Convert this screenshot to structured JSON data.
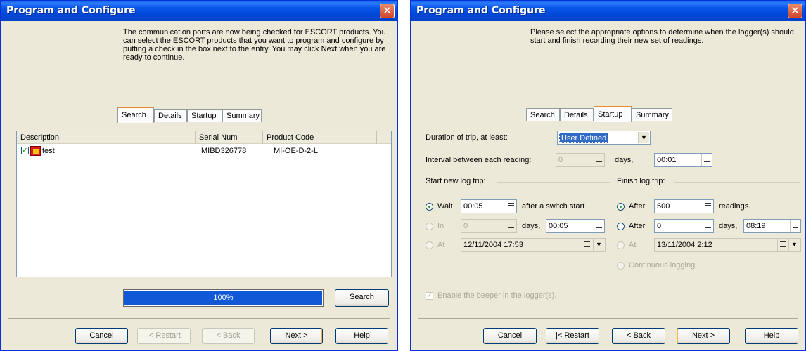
{
  "left_dialog": {
    "title": "Program and Configure",
    "close_glyph": "✕",
    "intro_text": "The communication ports are now being checked for ESCORT products. You can select the ESCORT products that you want to program and configure by putting a check in the box next to the entry. You may click Next when you are ready to continue.",
    "tabs": [
      "Search",
      "Details",
      "Startup",
      "Summary"
    ],
    "active_tab": "Search",
    "list": {
      "columns": [
        "Description",
        "Serial Num",
        "Product Code"
      ],
      "rows": [
        {
          "checked": true,
          "icon": "escort-device-icon",
          "description": "test",
          "serial": "MIBD326778",
          "product_code": "MI-OE-D-2-L"
        }
      ]
    },
    "progress": {
      "value": 100,
      "label": "100%"
    },
    "search_button": "Search",
    "buttons": {
      "cancel": "Cancel",
      "restart": "|< Restart",
      "back": "< Back",
      "next": "Next >",
      "help": "Help"
    }
  },
  "right_dialog": {
    "title": "Program and Configure",
    "close_glyph": "✕",
    "intro_text": "Please select the appropriate options to determine when the logger(s) should start and finish recording their new set of readings.",
    "tabs": [
      "Search",
      "Details",
      "Startup",
      "Summary"
    ],
    "active_tab": "Startup",
    "duration_label": "Duration of trip, at least:",
    "duration_value": "User Defined",
    "interval_label": "Interval between each reading:",
    "interval_days_value": "0",
    "interval_days_unit": "days,",
    "interval_time_value": "00:01",
    "start_group": "Start new log trip:",
    "finish_group": "Finish log trip:",
    "start_options": {
      "wait_label": "Wait",
      "wait_value": "00:05",
      "wait_suffix": "after a switch start",
      "in_label": "In",
      "in_days_value": "0",
      "in_days_unit": "days,",
      "in_time_value": "00:05",
      "at_label": "At",
      "at_value": "12/11/2004  17:53"
    },
    "finish_options": {
      "after_readings_label": "After",
      "after_readings_value": "500",
      "after_readings_suffix": "readings.",
      "after_days_label": "After",
      "after_days_value": "0",
      "after_days_unit": "days,",
      "after_time_value": "08:19",
      "at_label": "At",
      "at_value": "13/11/2004  2:12",
      "continuous_label": "Continuous logging"
    },
    "beeper_label": "Enable the beeper in the logger(s).",
    "buttons": {
      "cancel": "Cancel",
      "restart": "|< Restart",
      "back": "< Back",
      "next": "Next >",
      "help": "Help"
    }
  }
}
